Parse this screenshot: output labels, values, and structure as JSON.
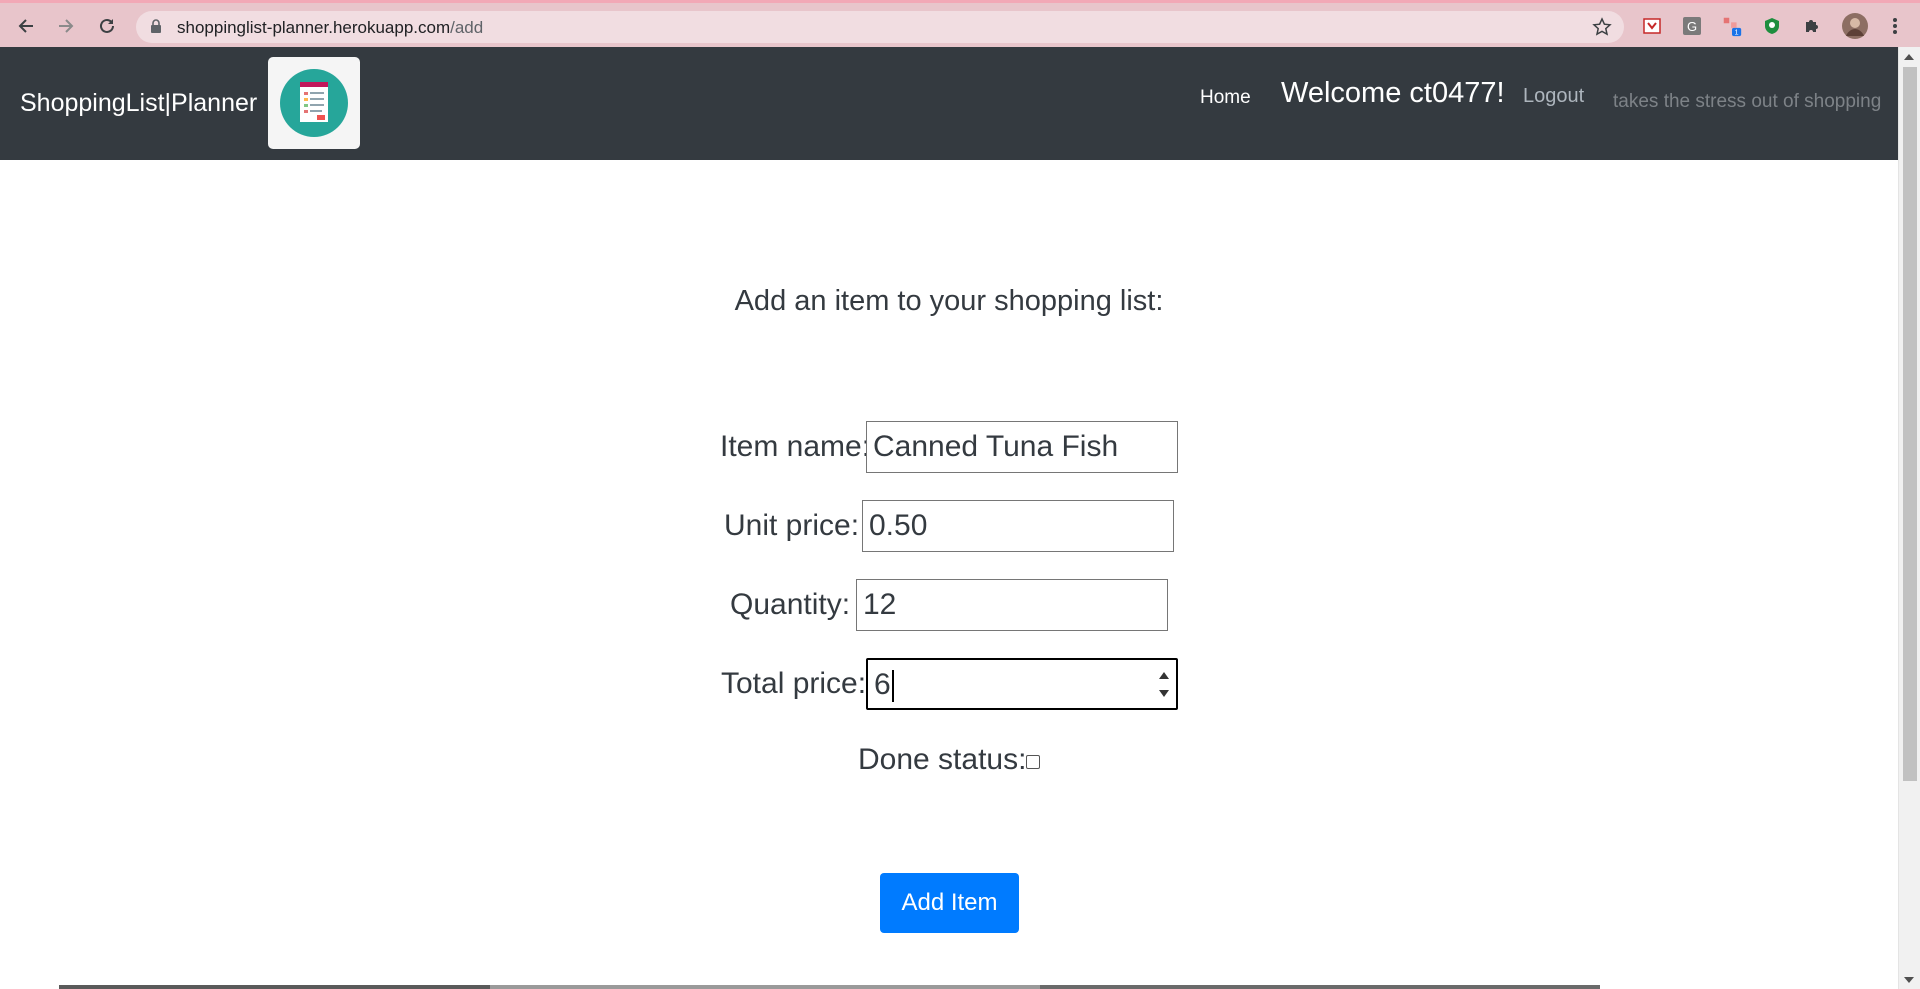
{
  "browser": {
    "url_host": "shoppinglist-planner.herokuapp.com",
    "url_path": "/add",
    "extension_badge": "1",
    "icons": [
      "back-icon",
      "forward-icon",
      "reload-icon",
      "lock-icon",
      "bookmark-star-icon",
      "extensions-puzzle-icon",
      "profile-avatar",
      "menu-kebab-icon"
    ]
  },
  "navbar": {
    "brand": "ShoppingList|Planner",
    "home": "Home",
    "welcome": "Welcome ct0477!",
    "logout": "Logout",
    "tagline": "takes the stress out of shopping"
  },
  "form": {
    "heading": "Add an item to your shopping list:",
    "item_name_label": "Item name:",
    "item_name_value": "Canned Tuna Fish",
    "unit_price_label": "Unit price:",
    "unit_price_value": "0.50",
    "quantity_label": "Quantity:",
    "quantity_value": "12",
    "total_price_label": "Total price:",
    "total_price_value": "6",
    "done_status_label": "Done status:",
    "done_status_checked": false,
    "submit_label": "Add Item"
  },
  "colors": {
    "navbar_bg": "#343a40",
    "primary": "#007bff",
    "chrome_bg": "#e8c5cb"
  }
}
